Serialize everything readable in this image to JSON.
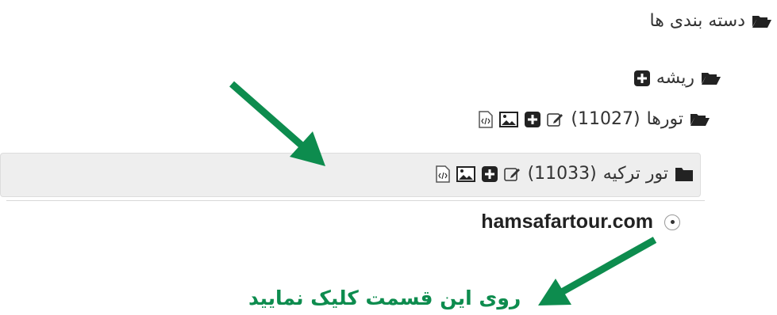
{
  "tree": {
    "root_label": "دسته بندی ها",
    "level1_label": "ریشه",
    "level2": {
      "label": "تورها",
      "count": "(11027)"
    },
    "level3": {
      "label": "تور ترکیه",
      "count": "(11033)"
    },
    "option": {
      "domain": "hamsafartour.com"
    }
  },
  "annotation": {
    "text": "روی این قسمت کلیک نمایید",
    "color": "#0d8c4e"
  },
  "icons": [
    "folder-open-icon",
    "folder-icon",
    "plus-square-icon",
    "edit-icon",
    "image-icon",
    "code-file-icon",
    "radio-icon",
    "arrow-icon"
  ]
}
